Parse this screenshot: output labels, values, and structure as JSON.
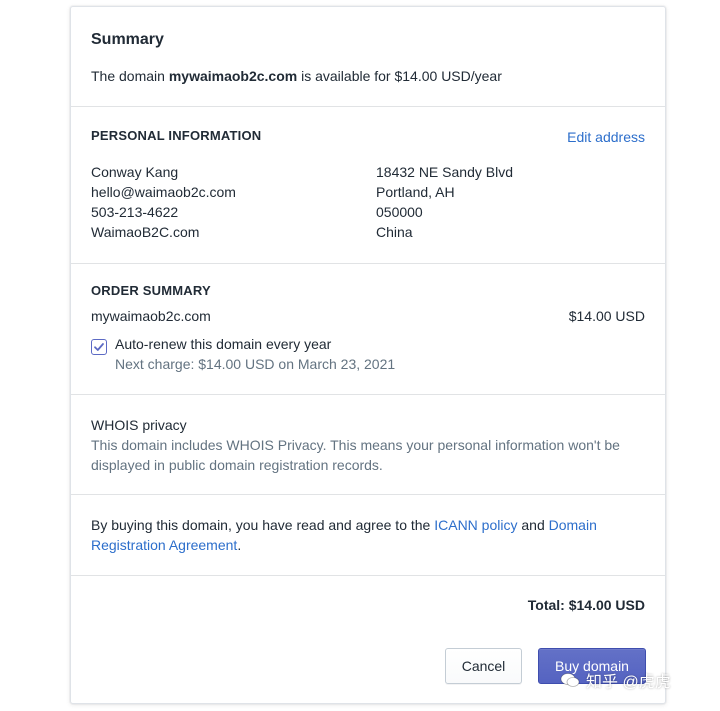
{
  "summary": {
    "title": "Summary",
    "text_prefix": "The domain ",
    "domain": "mywaimaob2c.com",
    "text_suffix": " is available for $14.00 USD/year"
  },
  "personal_info": {
    "heading": "PERSONAL INFORMATION",
    "edit_label": "Edit address",
    "name": "Conway Kang",
    "email": "hello@waimaob2c.com",
    "phone": "503-213-4622",
    "company": "WaimaoB2C.com",
    "street": "18432 NE Sandy Blvd",
    "city_state": "Portland, AH",
    "zip": "050000",
    "country": "China"
  },
  "order": {
    "heading": "ORDER SUMMARY",
    "domain": "mywaimaob2c.com",
    "price": "$14.00 USD",
    "auto_renew_label": "Auto-renew this domain every year",
    "auto_renew_checked": true,
    "next_charge": "Next charge: $14.00 USD on March 23, 2021"
  },
  "whois": {
    "title": "WHOIS privacy",
    "line1": "This domain includes WHOIS Privacy. This means your personal information won't be",
    "line2": "displayed in public domain registration records."
  },
  "agreement": {
    "prefix": "By buying this domain, you have read and agree to the ",
    "icann_link": "ICANN policy",
    "and": " and ",
    "link_part1": "Domain",
    "link_part2": "Registration Agreement",
    "period": "."
  },
  "total": {
    "label": "Total: $14.00 USD"
  },
  "actions": {
    "cancel_label": "Cancel",
    "buy_label": "Buy domain"
  },
  "watermark": {
    "text": "知乎 @虎虎"
  },
  "colors": {
    "link": "#2c6ecb",
    "primary": "#5c6ac4",
    "text": "#212b36",
    "subdued": "#637381"
  }
}
